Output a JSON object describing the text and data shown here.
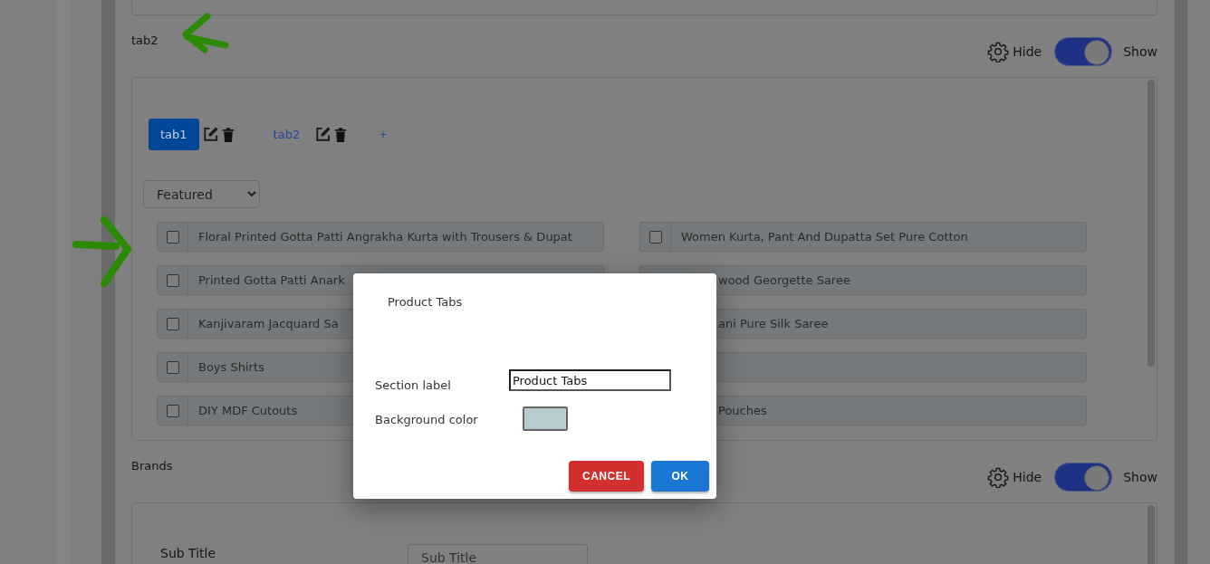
{
  "sections": [
    {
      "kind": "tabs",
      "title": "tab2",
      "visibility": {
        "hide_label": "Hide",
        "show_label": "Show",
        "on": true
      },
      "tabs": [
        {
          "label": "tab1",
          "selected": true
        },
        {
          "label": "tab2",
          "selected": false
        }
      ],
      "add_label": "+",
      "sort": {
        "value": "Featured"
      },
      "products": [
        {
          "kind": "full",
          "text": "Floral Printed Gotta Patti Angrakha Kurta with Trousers & Dupat",
          "checked": false
        },
        {
          "kind": "full",
          "text": "Women Kurta, Pant And Dupatta Set Pure Cotton",
          "checked": false
        },
        {
          "kind": "full",
          "text": "Printed Gotta Patti Anark",
          "checked": false
        },
        {
          "kind": "covered",
          "text": "wood Georgette Saree"
        },
        {
          "kind": "full",
          "text": "Kanjivaram Jacquard Sa",
          "checked": false
        },
        {
          "kind": "covered",
          "text": "ani Pure Silk Saree"
        },
        {
          "kind": "full",
          "text": "Boys Shirts",
          "checked": false
        },
        {
          "kind": "covered"
        },
        {
          "kind": "full",
          "text": "DIY MDF Cutouts",
          "checked": false
        },
        {
          "kind": "covered",
          "text": "Pouches"
        }
      ]
    },
    {
      "kind": "form",
      "title": "Brands",
      "visibility": {
        "hide_label": "Hide",
        "show_label": "Show",
        "on": true
      },
      "fields": [
        {
          "label": "Sub Title",
          "placeholder": "Sub Title"
        }
      ]
    }
  ],
  "dialog": {
    "title": "Product Tabs",
    "fields": [
      {
        "kind": "text",
        "label": "Section label",
        "value": "Product Tabs"
      },
      {
        "kind": "color",
        "label": "Background color",
        "color": "#b8cbd0"
      }
    ],
    "buttons": [
      {
        "kind": "cancel",
        "label": "CANCEL"
      },
      {
        "kind": "ok",
        "label": "OK"
      }
    ]
  }
}
